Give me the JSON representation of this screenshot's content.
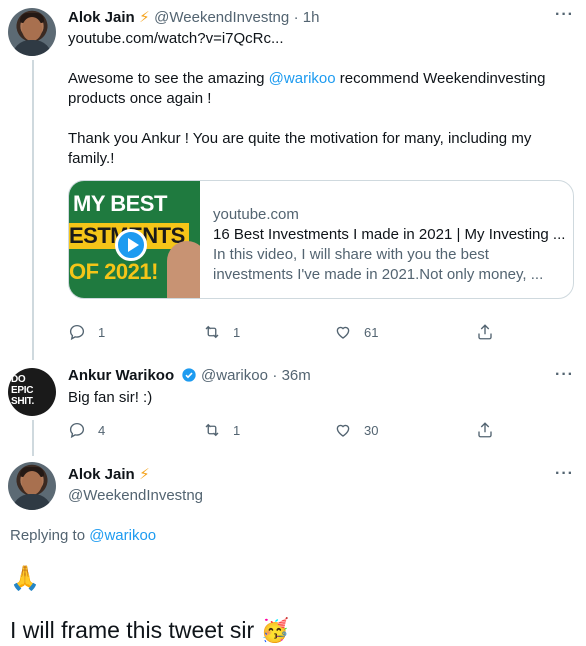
{
  "tweet1": {
    "name": "Alok Jain",
    "emoji": "⚡",
    "handle": "@WeekendInvestng",
    "time": "· 1h",
    "link": "youtube.com/watch?v=i7QcRc...",
    "line1_pre": "Awesome to see the amazing ",
    "mention": "@warikoo",
    "line1_post": " recommend Weekendinvesting",
    "line2": "products once again !",
    "line3": "Thank you Ankur !  You are quite the motivation for many, including my",
    "line4": "family.!",
    "card": {
      "thumb_line1": "MY BEST",
      "thumb_line2": "ESTMENTS",
      "thumb_line3": "OF 2021!",
      "domain": "youtube.com",
      "title": "16 Best Investments I made in 2021 | My Investing ...",
      "desc1": "In this video, I will share with you the best",
      "desc2": "investments I've made in 2021.Not only money, ..."
    },
    "replies": "1",
    "retweets": "1",
    "likes": "61"
  },
  "tweet2": {
    "avatar_text1": "DO",
    "avatar_text2": "EPIC",
    "avatar_text3": "SHIT.",
    "name": "Ankur Warikoo",
    "handle": "@warikoo",
    "time": "· 36m",
    "text": "Big fan sir! :)",
    "replies": "4",
    "retweets": "1",
    "likes": "30"
  },
  "tweet3": {
    "name": "Alok Jain",
    "emoji": "⚡",
    "handle": "@WeekendInvestng",
    "replying_label": "Replying to ",
    "replying_to": "@warikoo",
    "emoji_line": "🙏",
    "text": "I will frame this tweet sir",
    "text_emoji": "🥳"
  },
  "more_label": "···",
  "colors": {
    "accent": "#1d9bf0",
    "muted": "#536471",
    "border": "#cfd9de"
  }
}
